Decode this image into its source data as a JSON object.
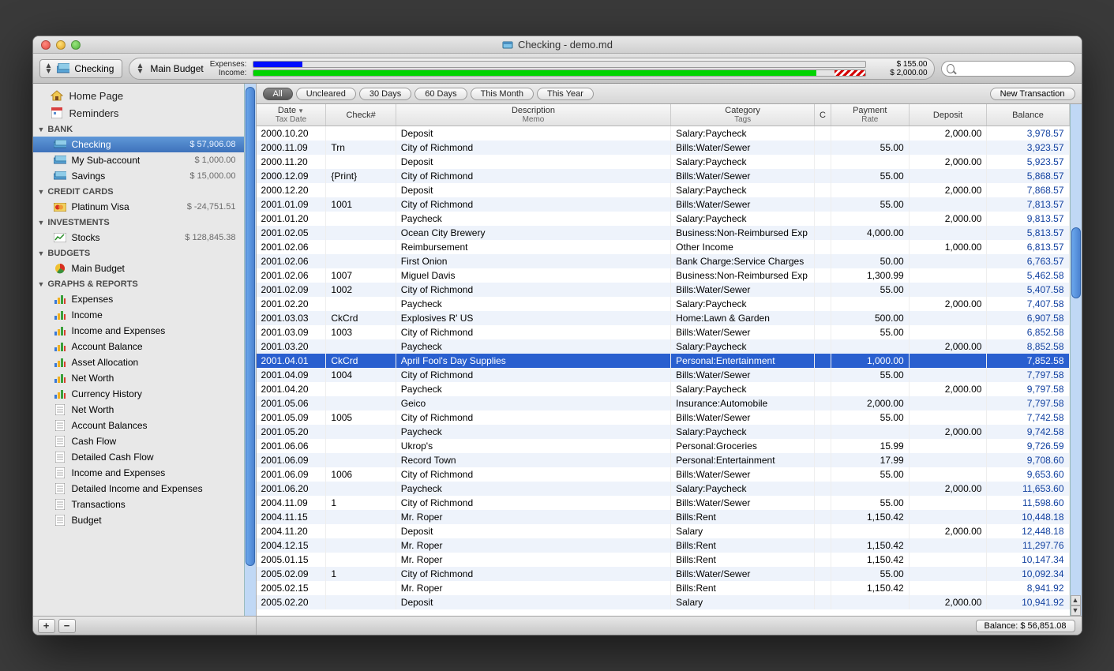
{
  "window": {
    "title": "Checking - demo.md"
  },
  "toolbar": {
    "account_name": "Checking",
    "budget_name": "Main Budget",
    "expenses_label": "Expenses:",
    "income_label": "Income:",
    "expenses_value": "$ 155.00",
    "income_value": "$ 2,000.00",
    "search_placeholder": ""
  },
  "sidebar": {
    "home_label": "Home Page",
    "reminders_label": "Reminders",
    "sections": [
      {
        "title": "BANK",
        "items": [
          {
            "name": "Checking",
            "balance": "$ 57,906.08",
            "selected": true,
            "icon": "checkbook"
          },
          {
            "name": "My Sub-account",
            "balance": "$ 1,000.00",
            "icon": "checkbook"
          },
          {
            "name": "Savings",
            "balance": "$ 15,000.00",
            "icon": "checkbook"
          }
        ]
      },
      {
        "title": "CREDIT CARDS",
        "items": [
          {
            "name": "Platinum Visa",
            "balance": "$ -24,751.51",
            "icon": "card"
          }
        ]
      },
      {
        "title": "INVESTMENTS",
        "items": [
          {
            "name": "Stocks",
            "balance": "$ 128,845.38",
            "icon": "stocks"
          }
        ]
      },
      {
        "title": "BUDGETS",
        "items": [
          {
            "name": "Main Budget",
            "balance": "",
            "icon": "pie"
          }
        ]
      },
      {
        "title": "GRAPHS & REPORTS",
        "items": [
          {
            "name": "Expenses",
            "icon": "chart"
          },
          {
            "name": "Income",
            "icon": "chart"
          },
          {
            "name": "Income and Expenses",
            "icon": "chart"
          },
          {
            "name": "Account Balance",
            "icon": "chart"
          },
          {
            "name": "Asset Allocation",
            "icon": "chart"
          },
          {
            "name": "Net Worth",
            "icon": "chart"
          },
          {
            "name": "Currency History",
            "icon": "chart"
          },
          {
            "name": "Net Worth",
            "icon": "doc"
          },
          {
            "name": "Account Balances",
            "icon": "doc"
          },
          {
            "name": "Cash Flow",
            "icon": "doc"
          },
          {
            "name": "Detailed Cash Flow",
            "icon": "doc"
          },
          {
            "name": "Income and Expenses",
            "icon": "doc"
          },
          {
            "name": "Detailed Income and Expenses",
            "icon": "doc"
          },
          {
            "name": "Transactions",
            "icon": "doc"
          },
          {
            "name": "Budget",
            "icon": "doc"
          }
        ]
      }
    ]
  },
  "filters": {
    "items": [
      "All",
      "Uncleared",
      "30 Days",
      "60 Days",
      "This Month",
      "This Year"
    ],
    "active": 0,
    "new_transaction": "New Transaction"
  },
  "columns": {
    "date": "Date",
    "date_sub": "Tax Date",
    "check": "Check#",
    "desc": "Description",
    "desc_sub": "Memo",
    "cat": "Category",
    "cat_sub": "Tags",
    "c": "C",
    "pay": "Payment",
    "pay_sub": "Rate",
    "dep": "Deposit",
    "bal": "Balance"
  },
  "transactions": [
    {
      "date": "2000.10.20",
      "check": "",
      "desc": "Deposit",
      "cat": "Salary:Paycheck",
      "pay": "",
      "dep": "2,000.00",
      "bal": "3,978.57"
    },
    {
      "date": "2000.11.09",
      "check": "Trn",
      "desc": "City of Richmond",
      "cat": "Bills:Water/Sewer",
      "pay": "55.00",
      "dep": "",
      "bal": "3,923.57"
    },
    {
      "date": "2000.11.20",
      "check": "",
      "desc": "Deposit",
      "cat": "Salary:Paycheck",
      "pay": "",
      "dep": "2,000.00",
      "bal": "5,923.57"
    },
    {
      "date": "2000.12.09",
      "check": "{Print}",
      "desc": "City of Richmond",
      "cat": "Bills:Water/Sewer",
      "pay": "55.00",
      "dep": "",
      "bal": "5,868.57"
    },
    {
      "date": "2000.12.20",
      "check": "",
      "desc": "Deposit",
      "cat": "Salary:Paycheck",
      "pay": "",
      "dep": "2,000.00",
      "bal": "7,868.57"
    },
    {
      "date": "2001.01.09",
      "check": "1001",
      "desc": "City of Richmond",
      "cat": "Bills:Water/Sewer",
      "pay": "55.00",
      "dep": "",
      "bal": "7,813.57"
    },
    {
      "date": "2001.01.20",
      "check": "",
      "desc": "Paycheck",
      "cat": "Salary:Paycheck",
      "pay": "",
      "dep": "2,000.00",
      "bal": "9,813.57"
    },
    {
      "date": "2001.02.05",
      "check": "",
      "desc": "Ocean City Brewery",
      "cat": "Business:Non-Reimbursed Exp",
      "pay": "4,000.00",
      "dep": "",
      "bal": "5,813.57"
    },
    {
      "date": "2001.02.06",
      "check": "",
      "desc": "Reimbursement",
      "cat": "Other Income",
      "pay": "",
      "dep": "1,000.00",
      "bal": "6,813.57"
    },
    {
      "date": "2001.02.06",
      "check": "",
      "desc": "First Onion",
      "cat": "Bank Charge:Service Charges",
      "pay": "50.00",
      "dep": "",
      "bal": "6,763.57"
    },
    {
      "date": "2001.02.06",
      "check": "1007",
      "desc": "Miguel Davis",
      "cat": "Business:Non-Reimbursed Exp",
      "pay": "1,300.99",
      "dep": "",
      "bal": "5,462.58"
    },
    {
      "date": "2001.02.09",
      "check": "1002",
      "desc": "City of Richmond",
      "cat": "Bills:Water/Sewer",
      "pay": "55.00",
      "dep": "",
      "bal": "5,407.58"
    },
    {
      "date": "2001.02.20",
      "check": "",
      "desc": "Paycheck",
      "cat": "Salary:Paycheck",
      "pay": "",
      "dep": "2,000.00",
      "bal": "7,407.58"
    },
    {
      "date": "2001.03.03",
      "check": "CkCrd",
      "desc": "Explosives R' US",
      "cat": "Home:Lawn & Garden",
      "pay": "500.00",
      "dep": "",
      "bal": "6,907.58"
    },
    {
      "date": "2001.03.09",
      "check": "1003",
      "desc": "City of Richmond",
      "cat": "Bills:Water/Sewer",
      "pay": "55.00",
      "dep": "",
      "bal": "6,852.58"
    },
    {
      "date": "2001.03.20",
      "check": "",
      "desc": "Paycheck",
      "cat": "Salary:Paycheck",
      "pay": "",
      "dep": "2,000.00",
      "bal": "8,852.58"
    },
    {
      "date": "2001.04.01",
      "check": "CkCrd",
      "desc": "April Fool's Day Supplies",
      "cat": "Personal:Entertainment",
      "pay": "1,000.00",
      "dep": "",
      "bal": "7,852.58",
      "selected": true
    },
    {
      "date": "2001.04.09",
      "check": "1004",
      "desc": "City of Richmond",
      "cat": "Bills:Water/Sewer",
      "pay": "55.00",
      "dep": "",
      "bal": "7,797.58"
    },
    {
      "date": "2001.04.20",
      "check": "",
      "desc": "Paycheck",
      "cat": "Salary:Paycheck",
      "pay": "",
      "dep": "2,000.00",
      "bal": "9,797.58"
    },
    {
      "date": "2001.05.06",
      "check": "",
      "desc": "Geico",
      "cat": "Insurance:Automobile",
      "pay": "2,000.00",
      "dep": "",
      "bal": "7,797.58"
    },
    {
      "date": "2001.05.09",
      "check": "1005",
      "desc": "City of Richmond",
      "cat": "Bills:Water/Sewer",
      "pay": "55.00",
      "dep": "",
      "bal": "7,742.58"
    },
    {
      "date": "2001.05.20",
      "check": "",
      "desc": "Paycheck",
      "cat": "Salary:Paycheck",
      "pay": "",
      "dep": "2,000.00",
      "bal": "9,742.58"
    },
    {
      "date": "2001.06.06",
      "check": "",
      "desc": "Ukrop's",
      "cat": "Personal:Groceries",
      "pay": "15.99",
      "dep": "",
      "bal": "9,726.59"
    },
    {
      "date": "2001.06.09",
      "check": "",
      "desc": "Record Town",
      "cat": "Personal:Entertainment",
      "pay": "17.99",
      "dep": "",
      "bal": "9,708.60"
    },
    {
      "date": "2001.06.09",
      "check": "1006",
      "desc": "City of Richmond",
      "cat": "Bills:Water/Sewer",
      "pay": "55.00",
      "dep": "",
      "bal": "9,653.60"
    },
    {
      "date": "2001.06.20",
      "check": "",
      "desc": "Paycheck",
      "cat": "Salary:Paycheck",
      "pay": "",
      "dep": "2,000.00",
      "bal": "11,653.60"
    },
    {
      "date": "2004.11.09",
      "check": "1",
      "desc": "City of Richmond",
      "cat": "Bills:Water/Sewer",
      "pay": "55.00",
      "dep": "",
      "bal": "11,598.60"
    },
    {
      "date": "2004.11.15",
      "check": "",
      "desc": "Mr. Roper",
      "cat": "Bills:Rent",
      "pay": "1,150.42",
      "dep": "",
      "bal": "10,448.18"
    },
    {
      "date": "2004.11.20",
      "check": "",
      "desc": "Deposit",
      "cat": "Salary",
      "pay": "",
      "dep": "2,000.00",
      "bal": "12,448.18"
    },
    {
      "date": "2004.12.15",
      "check": "",
      "desc": "Mr. Roper",
      "cat": "Bills:Rent",
      "pay": "1,150.42",
      "dep": "",
      "bal": "11,297.76"
    },
    {
      "date": "2005.01.15",
      "check": "",
      "desc": "Mr. Roper",
      "cat": "Bills:Rent",
      "pay": "1,150.42",
      "dep": "",
      "bal": "10,147.34"
    },
    {
      "date": "2005.02.09",
      "check": "1",
      "desc": "City of Richmond",
      "cat": "Bills:Water/Sewer",
      "pay": "55.00",
      "dep": "",
      "bal": "10,092.34"
    },
    {
      "date": "2005.02.15",
      "check": "",
      "desc": "Mr. Roper",
      "cat": "Bills:Rent",
      "pay": "1,150.42",
      "dep": "",
      "bal": "8,941.92"
    },
    {
      "date": "2005.02.20",
      "check": "",
      "desc": "Deposit",
      "cat": "Salary",
      "pay": "",
      "dep": "2,000.00",
      "bal": "10,941.92"
    }
  ],
  "status": {
    "balance_label": "Balance: $ 56,851.08"
  }
}
